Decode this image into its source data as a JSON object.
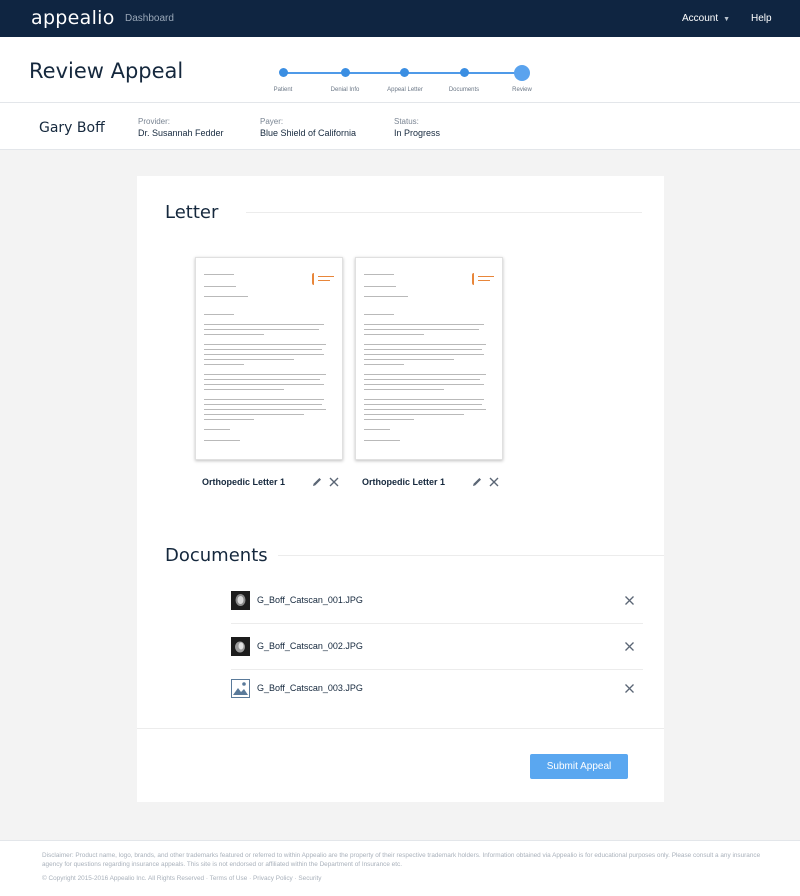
{
  "nav": {
    "brand": "appealio",
    "dashboard": "Dashboard",
    "account": "Account",
    "help": "Help"
  },
  "page": {
    "title": "Review Appeal"
  },
  "stepper": {
    "steps": [
      "Patient",
      "Denial Info",
      "Appeal Letter",
      "Documents",
      "Review"
    ],
    "current": "Review"
  },
  "patient": {
    "name": "Gary Boff",
    "provider_label": "Provider:",
    "provider_value": "Dr. Susannah Fedder",
    "payer_label": "Payer:",
    "payer_value": "Blue Shield of California",
    "status_label": "Status:",
    "status_value": "In Progress"
  },
  "letter_section": {
    "title": "Letter",
    "letters": [
      {
        "name": "Orthopedic Letter 1"
      },
      {
        "name": "Orthopedic Letter 1"
      }
    ]
  },
  "documents_section": {
    "title": "Documents",
    "files": [
      {
        "name": "G_Boff_Catscan_001.JPG",
        "thumb": "xray-image"
      },
      {
        "name": "G_Boff_Catscan_002.JPG",
        "thumb": "xray-image"
      },
      {
        "name": "G_Boff_Catscan_003.JPG",
        "thumb": "image-placeholder-icon"
      }
    ]
  },
  "actions": {
    "submit": "Submit Appeal"
  },
  "footer": {
    "disclaimer": "Disclaimer: Product name, logo, brands, and other trademarks featured or referred to within Appealio are the property of their respective trademark holders. Information obtained via Appealio is for educational purposes only. Please consult a any insurance agency for questions regarding insurance appeals. This site is not endorsed or affiliated within the Department of Insurance etc.",
    "copyright": "© Copyright 2015-2016 Appealio Inc. All Rights Reserved · Terms of Use · Privacy Policy · Security"
  },
  "colors": {
    "nav_bg": "#0f2541",
    "accent": "#3b8ee2",
    "button": "#5aa7f0",
    "text": "#15283d"
  }
}
